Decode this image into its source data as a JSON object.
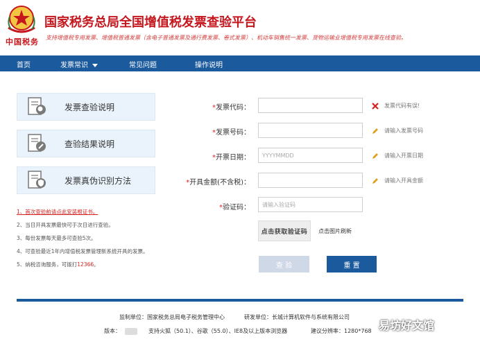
{
  "header": {
    "title": "国家税务总局全国增值税发票查验平台",
    "subtitle": "支持增值税专用发票、增值税普通发票（含电子普通发票及通行费发票、卷式发票）、机动车销售统一发票、货物运输业增值税专用发票在线查验。",
    "logo_text": "中国税务"
  },
  "nav": {
    "items": [
      {
        "label": "首页"
      },
      {
        "label": "发票常识"
      },
      {
        "label": "常见问题"
      },
      {
        "label": "操作说明"
      }
    ]
  },
  "sidebar": {
    "cards": [
      {
        "label": "发票查验说明",
        "icon": "document-search-icon"
      },
      {
        "label": "查验结果说明",
        "icon": "document-edit-icon"
      },
      {
        "label": "发票真伪识别方法",
        "icon": "document-shield-icon"
      }
    ]
  },
  "notes": {
    "n1": "1、首次查验前请点此安装根证书。",
    "n2": "2、当日开具发票最快可于次日进行查验。",
    "n3": "3、每份发票每天最多可查验5次。",
    "n4": "4、可查验最近1年内增值税发票管理新系统开具的发票。",
    "n5_prefix": "5、纳税咨询服务，可拨打",
    "n5_phone": "12366",
    "n5_suffix": "。"
  },
  "form": {
    "fields": [
      {
        "label": "发票代码：",
        "value": "",
        "placeholder": "",
        "status": "发票代码有误!",
        "status_icon": "error-x-icon"
      },
      {
        "label": "发票号码：",
        "value": "",
        "placeholder": "",
        "status": "请输入发票号码",
        "status_icon": "pencil-icon"
      },
      {
        "label": "开票日期：",
        "value": "",
        "placeholder": "YYYYMMDD",
        "status": "请输入开票日期",
        "status_icon": "pencil-icon"
      },
      {
        "label": "开具金额(不含税)：",
        "value": "",
        "placeholder": "",
        "status": "请输入开具金额",
        "status_icon": "pencil-icon"
      },
      {
        "label": "验证码：",
        "value": "",
        "placeholder": "请输入验证码"
      }
    ],
    "captcha_text": "点击获取验证码",
    "captcha_hint": "点击图片刷新",
    "check_label": "查 验",
    "reset_label": "重 置"
  },
  "footer": {
    "supervisor": "监制单位：国家税务总局电子税务管理中心",
    "developer": "研发单位：长城计算机软件与系统有限公司",
    "version_label": "版本：",
    "browser_support": "支持火狐（50.1）、谷歌（55.0）、IE8及以上版本浏览器",
    "resolution": "建议分辨率：1280*768"
  },
  "watermark": "易坊好文馆",
  "colors": {
    "brand_red": "#c4161c",
    "nav_blue": "#1b5a9d",
    "card_bg": "#eaf3fb"
  }
}
